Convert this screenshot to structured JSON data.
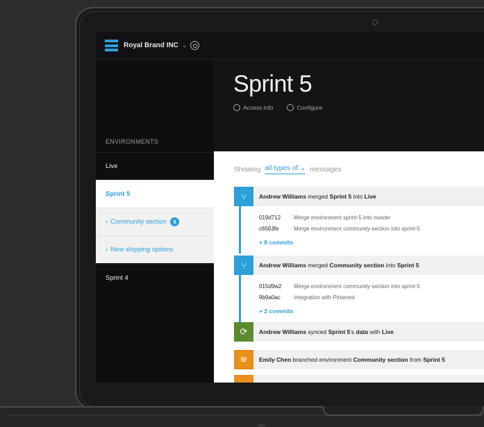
{
  "colors": {
    "accent": "#2d9fd9",
    "green": "#5c8a2f",
    "orange": "#ea8e1c"
  },
  "topbar": {
    "brand": "Royal Brand INC",
    "chevron": "⌄"
  },
  "sidebar": {
    "heading": "ENVIRONMENTS",
    "items": [
      {
        "label": "Live"
      },
      {
        "label": "Sprint 5"
      },
      {
        "label": "Community section",
        "badge": "3",
        "prefix": "›"
      },
      {
        "label": "New shipping options",
        "prefix": "›"
      },
      {
        "label": "Sprint 4"
      }
    ]
  },
  "header": {
    "title": "Sprint 5",
    "access": "Access info",
    "configure": "Configure"
  },
  "filter": {
    "prefix": "Showing",
    "value": "all types of ⌄",
    "suffix": "messages"
  },
  "events": [
    {
      "icon": "merge-icon",
      "user": "Andrew Williams",
      "verb": "merged",
      "from": "Sprint 5",
      "mid": "into",
      "to": "Live",
      "commits": [
        {
          "hash": "019d712",
          "msg": "Merge environment sprint-5 into master"
        },
        {
          "hash": "c6563fe",
          "msg": "Merge environment community-section into sprint-5"
        }
      ],
      "more": "+ 8 commits"
    },
    {
      "icon": "merge-icon",
      "user": "Andrew Williams",
      "verb": "merged",
      "from": "Community section",
      "mid": "into",
      "to": "Sprint 5",
      "commits": [
        {
          "hash": "015d9w2",
          "msg": "Merge environment community-section into sprint-5"
        },
        {
          "hash": "9b9a0ac",
          "msg": "Integration with Pinterest"
        }
      ],
      "more": "+ 2 commits"
    },
    {
      "icon": "sync-icon",
      "user": "Andrew Williams",
      "verb": "synced",
      "from": "Sprint 5",
      "mid": "'s",
      "mid2": "data",
      "mid3": "with",
      "to": "Live"
    },
    {
      "icon": "branch-icon",
      "user": "Emily Chen",
      "verb": "branched environment",
      "from": "Community section",
      "mid": "from",
      "to": "Sprint 5"
    }
  ]
}
